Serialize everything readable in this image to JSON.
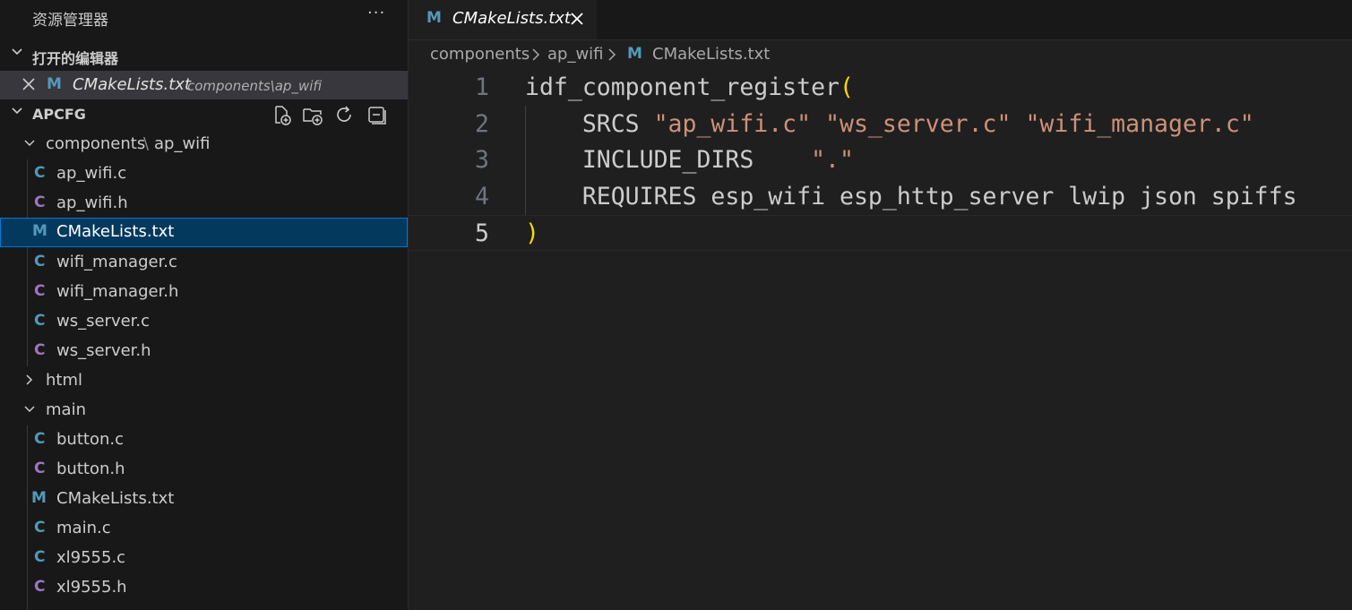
{
  "explorer": {
    "title": "资源管理器",
    "more": "···",
    "open_editors": {
      "header": "打开的编辑器",
      "items": [
        {
          "name": "CMakeLists.txt",
          "path": "components\\ap_wifi",
          "icon": "M"
        }
      ]
    },
    "workspace": {
      "header": "APCFG",
      "actions": [
        "new-file-icon",
        "new-folder-icon",
        "refresh-icon",
        "collapse-all-icon"
      ],
      "tree": [
        {
          "label": "components",
          "sep": "\\",
          "label2": "ap_wifi",
          "type": "folder",
          "expanded": true
        },
        {
          "label": "ap_wifi.c",
          "icon": "C",
          "kind": "source"
        },
        {
          "label": "ap_wifi.h",
          "icon": "C",
          "kind": "header"
        },
        {
          "label": "CMakeLists.txt",
          "icon": "M",
          "kind": "cmake",
          "selected": true
        },
        {
          "label": "wifi_manager.c",
          "icon": "C",
          "kind": "source"
        },
        {
          "label": "wifi_manager.h",
          "icon": "C",
          "kind": "header"
        },
        {
          "label": "ws_server.c",
          "icon": "C",
          "kind": "source"
        },
        {
          "label": "ws_server.h",
          "icon": "C",
          "kind": "header"
        },
        {
          "label": "html",
          "type": "folder",
          "expanded": false
        },
        {
          "label": "main",
          "type": "folder",
          "expanded": true
        },
        {
          "label": "button.c",
          "icon": "C",
          "kind": "source"
        },
        {
          "label": "button.h",
          "icon": "C",
          "kind": "header"
        },
        {
          "label": "CMakeLists.txt",
          "icon": "M",
          "kind": "cmake"
        },
        {
          "label": "main.c",
          "icon": "C",
          "kind": "source"
        },
        {
          "label": "xl9555.c",
          "icon": "C",
          "kind": "source"
        },
        {
          "label": "xl9555.h",
          "icon": "C",
          "kind": "header"
        }
      ]
    }
  },
  "editor": {
    "tab": {
      "label": "CMakeLists.txt",
      "icon": "M",
      "close": "✕"
    },
    "breadcrumb": [
      "components",
      "ap_wifi",
      "CMakeLists.txt"
    ],
    "breadcrumb_sep": ">",
    "lines": [
      {
        "n": "1",
        "parts": [
          [
            "plain",
            "idf_component_register"
          ],
          [
            "brk",
            "("
          ]
        ]
      },
      {
        "n": "2",
        "parts": [
          [
            "plain",
            "    SRCS "
          ],
          [
            "str",
            "\"ap_wifi.c\""
          ],
          [
            "plain",
            " "
          ],
          [
            "str",
            "\"ws_server.c\""
          ],
          [
            "plain",
            " "
          ],
          [
            "str",
            "\"wifi_manager.c\""
          ]
        ]
      },
      {
        "n": "3",
        "parts": [
          [
            "plain",
            "    INCLUDE_DIRS    "
          ],
          [
            "str",
            "\".\""
          ]
        ]
      },
      {
        "n": "4",
        "parts": [
          [
            "plain",
            "    REQUIRES esp_wifi esp_http_server lwip json spiffs"
          ]
        ]
      },
      {
        "n": "5",
        "parts": [
          [
            "brk",
            ")"
          ]
        ],
        "current": true
      }
    ]
  },
  "colors": {
    "sidebar_bg": "#181818",
    "editor_bg": "#1f1f1f",
    "selection_bg": "#04395e",
    "selection_border": "#0078d4",
    "c_source": "#519aba",
    "c_header": "#a074c4",
    "string": "#ce9178",
    "bracket": "#ffd700"
  }
}
